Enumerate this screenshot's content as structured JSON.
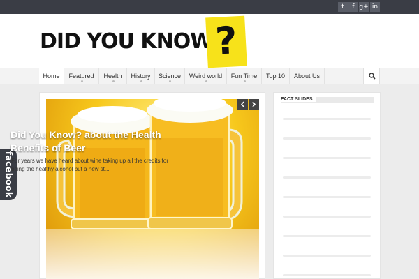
{
  "social": [
    {
      "icon": "twitter-icon",
      "glyph": "t"
    },
    {
      "icon": "facebook-icon",
      "glyph": "f"
    },
    {
      "icon": "google-plus-icon",
      "glyph": "g+"
    },
    {
      "icon": "linkedin-icon",
      "glyph": "in"
    }
  ],
  "logo": {
    "text": "DID YOU KNOW",
    "mark": "?"
  },
  "nav": {
    "items": [
      "Home",
      "Featured",
      "Health",
      "History",
      "Science",
      "Weird world",
      "Fun Time",
      "Top 10",
      "About Us"
    ],
    "active": 0,
    "search_icon": "search-icon"
  },
  "side_tab": {
    "label": "facebook"
  },
  "slider": {
    "title": "Did You Know? about the Health Benefits of Beer",
    "excerpt": "For years we have heard about wine taking up all the credits for being the healthy alcohol but a new st...",
    "prev_icon": "chevron-left-icon",
    "next_icon": "chevron-right-icon"
  },
  "sidebar": {
    "title": "FACT SLIDES"
  },
  "colors": {
    "topbar": "#3a3d45",
    "logo_yellow": "#f7e21a",
    "accent": "#f7c81c"
  }
}
